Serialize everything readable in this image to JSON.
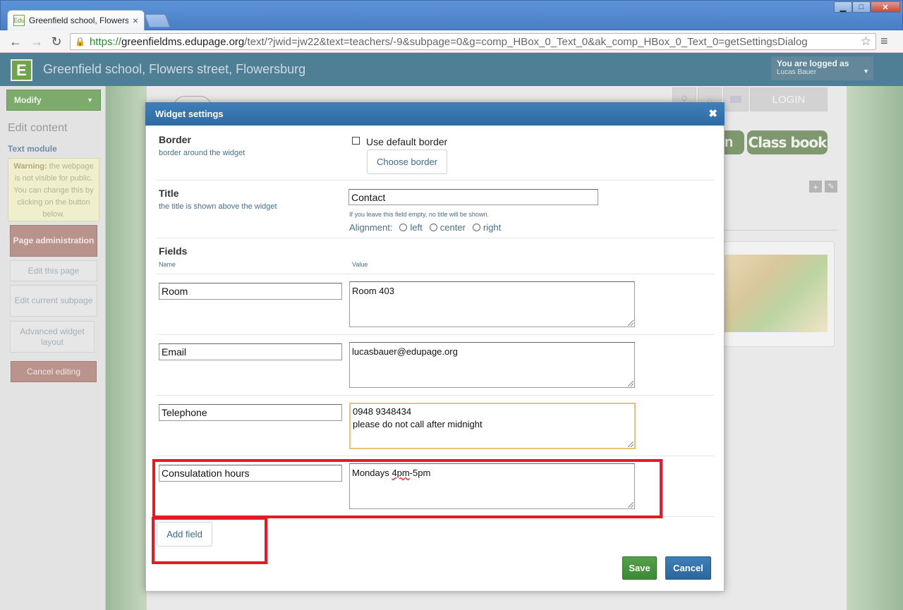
{
  "browser": {
    "tab_title": "Greenfield school, Flowers st",
    "tab_favicon_text": "Edu",
    "url": {
      "scheme": "https://",
      "host": "greenfieldms.edupage.org",
      "path": "/text/?jwid=jw22&text=teachers/-9&subpage=0&g=comp_HBox_0_Text_0&ak_comp_HBox_0_Text_0=getSettingsDialog"
    }
  },
  "site": {
    "title": "Greenfield school, Flowers street, Flowersburg",
    "logo_letter": "E",
    "login": {
      "label": "You are logged as",
      "user": "Lucas Bauer"
    }
  },
  "sidebar": {
    "modify": "Modify",
    "edit_content": "Edit content",
    "text_module": "Text module",
    "warning_bold": "Warning:",
    "warning_text": " the webpage is not visible for public. You can change this by clicking on the button below.",
    "page_admin": "Page administration",
    "edit_page": "Edit this page",
    "edit_subpage": "Edit current subpage",
    "advanced_layout": "Advanced widget layout",
    "cancel_editing": "Cancel editing"
  },
  "background_page": {
    "login": "LOGIN",
    "btn_partial": "n",
    "class_book": "Class book"
  },
  "dialog": {
    "title": "Widget settings",
    "close": "✖",
    "border": {
      "title": "Border",
      "subtitle": "border around the widget",
      "use_default": "Use default border",
      "use_default_checked": false,
      "choose": "Choose border"
    },
    "title_section": {
      "title": "Title",
      "subtitle": "the title is shown above the widget",
      "value": "Contact",
      "hint": "If you leave this field empty, no title will be shown.",
      "alignment_label": "Alignment:",
      "options": [
        "left",
        "center",
        "right"
      ]
    },
    "fields": {
      "title": "Fields",
      "col_name": "Name",
      "col_value": "Value",
      "rows": [
        {
          "name": "Room",
          "value": "Room 403"
        },
        {
          "name": "Email",
          "value": "lucasbauer@edupage.org"
        },
        {
          "name": "Telephone",
          "value": "0948 9348434\nplease do not call after midnight"
        },
        {
          "name": "Consulatation hours",
          "value_pre": "Mondays ",
          "value_misspelled": "4pm",
          "value_post": "-5pm"
        }
      ],
      "add_field": "Add field"
    },
    "save": "Save",
    "cancel": "Cancel"
  },
  "colors": {
    "highlight": "#e31b23",
    "save": "#3b8a34",
    "cancel": "#2c669e",
    "header": "#2f6aa3"
  }
}
